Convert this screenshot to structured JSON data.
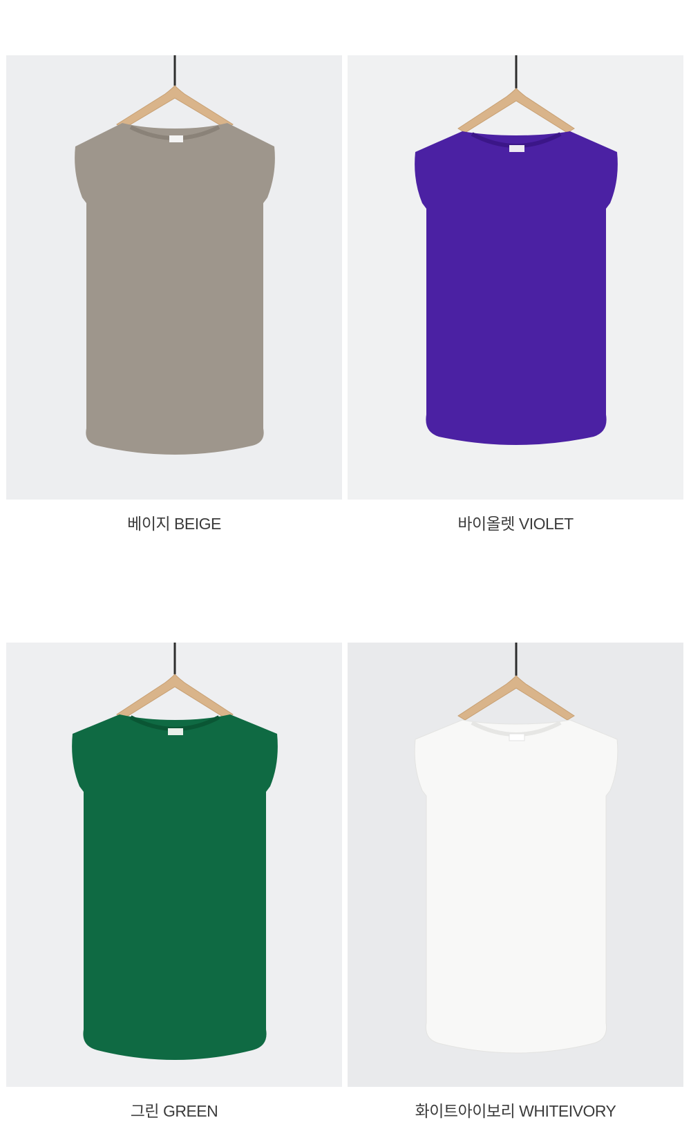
{
  "products": [
    {
      "id": "beige",
      "label": "베이지 BEIGE",
      "color": "#9e968c",
      "shade": "#8a8278",
      "light": "#b1aa9f"
    },
    {
      "id": "violet",
      "label": "바이올렛 VIOLET",
      "color": "#4b21a3",
      "shade": "#3b1688",
      "light": "#5a30b3"
    },
    {
      "id": "green",
      "label": "그린 GREEN",
      "color": "#0f6a43",
      "shade": "#0a5634",
      "light": "#177a4f"
    },
    {
      "id": "white",
      "label": "화이트아이보리 WHITEIVORY",
      "color": "#f8f8f7",
      "shade": "#e6e6e4",
      "light": "#ffffff"
    }
  ],
  "icons": {
    "hanger": "hanger-icon"
  }
}
